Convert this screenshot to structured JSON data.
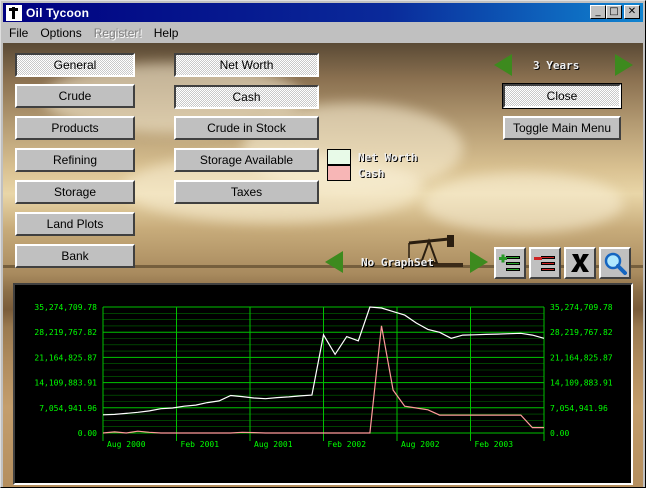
{
  "window": {
    "title": "Oil Tycoon",
    "min_glyph": "_",
    "max_glyph": "□",
    "close_glyph": "✕"
  },
  "menu": [
    {
      "label": "File",
      "disabled": false
    },
    {
      "label": "Options",
      "disabled": false
    },
    {
      "label": "Register!",
      "disabled": true
    },
    {
      "label": "Help",
      "disabled": false
    }
  ],
  "nav_buttons": [
    "General",
    "Crude",
    "Products",
    "Refining",
    "Storage",
    "Land Plots",
    "Bank"
  ],
  "graph_buttons": [
    "Net Worth",
    "Cash",
    "Crude in Stock",
    "Storage Available",
    "Taxes"
  ],
  "period": {
    "label": "3 Years"
  },
  "close_button": "Close",
  "toggle_button": "Toggle Main Menu",
  "legend": [
    {
      "label": "Net Worth",
      "color": "#e8fae8"
    },
    {
      "label": "Cash",
      "color": "#f7b6b6"
    }
  ],
  "graphset": {
    "label": "No GraphSet"
  },
  "tools": [
    "add-graph-icon",
    "remove-graph-icon",
    "clear-graph-icon",
    "zoom-icon"
  ],
  "colors": {
    "grid": "#00c000",
    "axis_text": "#00ff00",
    "net_worth": "#ffffff",
    "cash": "#ff9a9a",
    "arrow": "#3d8a1e"
  },
  "chart_data": {
    "type": "line",
    "title": "",
    "y_ticks": [
      "35,274,709.78",
      "28,219,767.82",
      "21,164,825.87",
      "14,109,883.91",
      "7,054,941.96",
      "0.00"
    ],
    "ylim": [
      0,
      35274709.78
    ],
    "x_ticks": [
      "Aug 2000",
      "Feb 2001",
      "Aug 2001",
      "Feb 2002",
      "Aug 2002",
      "Feb 2003"
    ],
    "grid": true,
    "series": [
      {
        "name": "Net Worth",
        "values": [
          5100000,
          5200000,
          5500000,
          5800000,
          6200000,
          6800000,
          7000000,
          7500000,
          7800000,
          8500000,
          9000000,
          10500000,
          10200000,
          9800000,
          9600000,
          9900000,
          10100000,
          10400000,
          10600000,
          27500000,
          22000000,
          27000000,
          25800000,
          35274709,
          35000000,
          34000000,
          33000000,
          30800000,
          29000000,
          28200000,
          26500000,
          27400000,
          27500000,
          27600000,
          27700000,
          27800000,
          27900000,
          27400000,
          26500000
        ]
      },
      {
        "name": "Cash",
        "values": [
          0,
          300000,
          0,
          500000,
          200000,
          0,
          0,
          0,
          0,
          0,
          0,
          0,
          200000,
          100000,
          0,
          0,
          0,
          0,
          0,
          0,
          0,
          0,
          0,
          0,
          30000000,
          12000000,
          7500000,
          7000000,
          6500000,
          5000000,
          5000000,
          5000000,
          5000000,
          5000000,
          5000000,
          5000000,
          5000000,
          1500000,
          1500000
        ]
      }
    ]
  }
}
